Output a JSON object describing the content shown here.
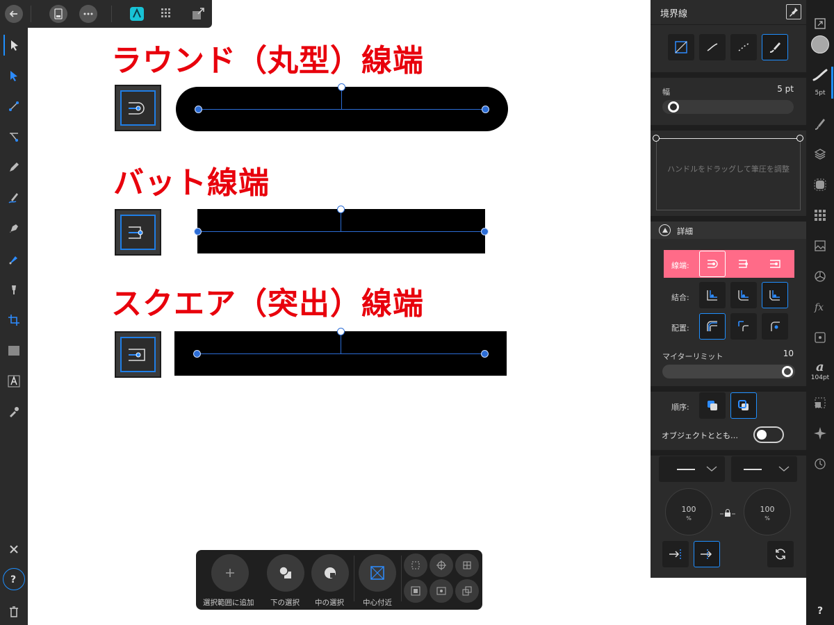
{
  "canvas": {
    "round_cap_heading": "ラウンド（丸型）線端",
    "butt_cap_heading": "バット線端",
    "square_cap_heading": "スクエア（突出）線端"
  },
  "context_toolbar": {
    "add_to_selection": "選択範囲に追加",
    "select_below": "下の選択",
    "select_inside": "中の選択",
    "near_center": "中心付近"
  },
  "stroke_panel": {
    "title": "境界線",
    "width_label": "幅",
    "width_value": "5 pt",
    "pressure_hint": "ハンドルをドラッグして筆圧を調整",
    "details_label": "詳細",
    "caps_label": "線端:",
    "join_label": "結合:",
    "align_label": "配置:",
    "miter_label": "マイターリミット",
    "miter_value": "10",
    "order_label": "順序:",
    "scale_with_object_label": "オブジェクトととも…",
    "start_scale": "100",
    "end_scale": "100",
    "scale_unit": "%"
  },
  "right_strip": {
    "brush_size": "5pt",
    "font_size": "104pt",
    "help": "?"
  },
  "colors": {
    "accent": "#1f8fff",
    "heading_red": "#e8000c",
    "caps_highlight": "#ff6b88",
    "panel_bg": "#2b2b2b"
  }
}
